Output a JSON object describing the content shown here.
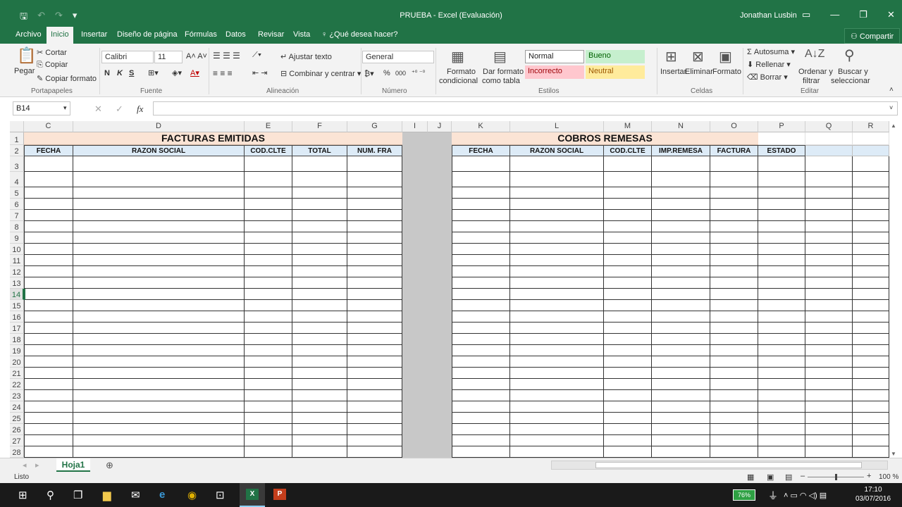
{
  "title": "PRUEBA - Excel (Evaluación)",
  "user": "Jonathan Lusbin",
  "tabs": [
    "Archivo",
    "Inicio",
    "Insertar",
    "Diseño de página",
    "Fórmulas",
    "Datos",
    "Revisar",
    "Vista"
  ],
  "tell_me": "¿Qué desea hacer?",
  "share": "Compartir",
  "ribbon": {
    "paste": "Pegar",
    "cut": "Cortar",
    "copy": "Copiar",
    "format_painter": "Copiar formato",
    "grp_clipboard": "Portapapeles",
    "font_name": "Calibri",
    "font_size": "11",
    "bold": "N",
    "italic": "K",
    "underline": "S",
    "grp_font": "Fuente",
    "wrap": "Ajustar texto",
    "merge": "Combinar y centrar",
    "grp_align": "Alineación",
    "number_format": "General",
    "percent": "%",
    "thousands": "000",
    "grp_number": "Número",
    "cond_format_1": "Formato",
    "cond_format_2": "condicional",
    "table_format_1": "Dar formato",
    "table_format_2": "como tabla",
    "style_normal": "Normal",
    "style_bueno": "Bueno",
    "style_incorrecto": "Incorrecto",
    "style_neutral": "Neutral",
    "grp_styles": "Estilos",
    "insert": "Insertar",
    "delete": "Eliminar",
    "format": "Formato",
    "grp_cells": "Celdas",
    "autosum": "Autosuma",
    "fill": "Rellenar",
    "clear": "Borrar",
    "sort_1": "Ordenar y",
    "sort_2": "filtrar",
    "find_1": "Buscar y",
    "find_2": "seleccionar",
    "grp_edit": "Editar"
  },
  "namebox": "B14",
  "fx_label": "fx",
  "columns": [
    "C",
    "D",
    "E",
    "F",
    "G",
    "I",
    "J",
    "K",
    "L",
    "M",
    "N",
    "O",
    "P",
    "Q",
    "R"
  ],
  "rows": [
    "1",
    "2",
    "3",
    "4",
    "5",
    "6",
    "7",
    "8",
    "9",
    "10",
    "11",
    "12",
    "13",
    "14",
    "15",
    "16",
    "17",
    "18",
    "19",
    "20",
    "21",
    "22",
    "23",
    "24",
    "25",
    "26",
    "27",
    "28"
  ],
  "left_title": "FACTURAS EMITIDAS",
  "left_headers": [
    "FECHA",
    "RAZON SOCIAL",
    "COD.CLTE",
    "TOTAL",
    "NUM. FRA"
  ],
  "right_title": "COBROS REMESAS",
  "right_headers": [
    "FECHA",
    "RAZON SOCIAL",
    "COD.CLTE",
    "IMP.REMESA",
    "FACTURA",
    "ESTADO"
  ],
  "sheet_tab": "Hoja1",
  "status": "Listo",
  "zoom": "100 %",
  "battery": "76%",
  "time": "17:10",
  "date": "03/07/2016"
}
